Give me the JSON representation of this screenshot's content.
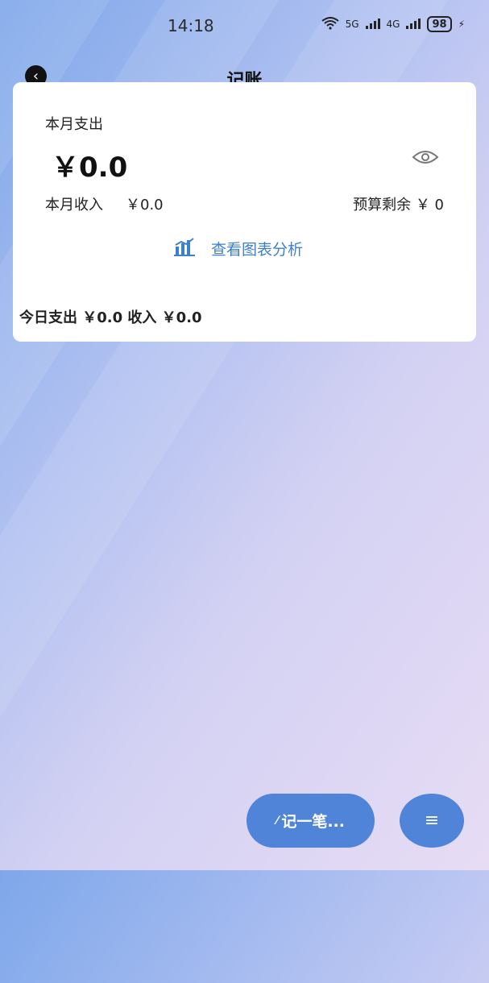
{
  "status_bar": {
    "time": "14:18",
    "network_1": "5G",
    "network_2": "4G",
    "battery": "98"
  },
  "nav": {
    "title": "记账"
  },
  "summary": {
    "month_expense_label": "本月支出",
    "month_expense_amount": "￥0.0",
    "month_income_label": "本月收入",
    "month_income_amount": "￥0.0",
    "budget_label": "预算剩余",
    "budget_amount": "￥ 0",
    "chart_link_label": "查看图表分析",
    "today_line": "今日支出 ￥0.0  收入 ￥0.0"
  },
  "actions": {
    "record_label": "记一笔...",
    "menu_icon": "hamburger-icon"
  },
  "colors": {
    "accent": "#4f84d8",
    "link": "#3d7fcf"
  }
}
